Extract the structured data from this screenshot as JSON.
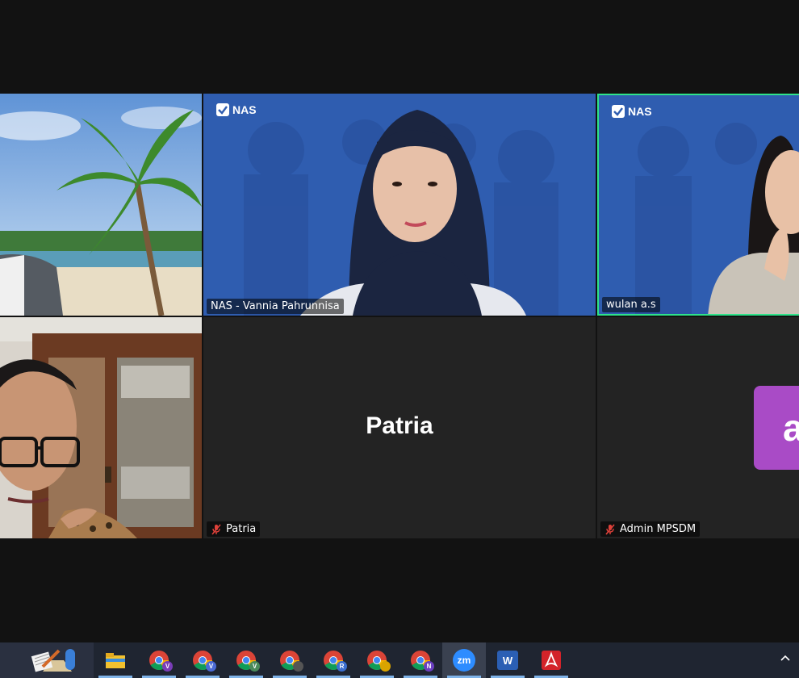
{
  "meeting": {
    "participants": [
      {
        "id": "beach",
        "name": ""
      },
      {
        "id": "vannia",
        "name": "NAS - Vannia Pahrunnisa",
        "logo": "NAS"
      },
      {
        "id": "wulan",
        "name": "wulan a.s",
        "logo": "NAS",
        "active_speaker": true
      },
      {
        "id": "man",
        "name": ""
      },
      {
        "id": "patria",
        "name": "Patria",
        "display_name": "Patria",
        "muted": true
      },
      {
        "id": "admin",
        "name": "Admin MPSDM",
        "avatar_letter": "a",
        "muted": true
      }
    ],
    "colors": {
      "active_speaker_border": "#2ee38a",
      "avatar_bg": "#a94bc6",
      "nas_background": "#2f5db0",
      "muted_icon": "#e0413a"
    }
  },
  "taskbar": {
    "items": [
      {
        "icon": "notepad-icon",
        "label": ""
      },
      {
        "icon": "file-explorer-icon",
        "label": ""
      },
      {
        "icon": "chrome-icon",
        "badge": "V",
        "badge_color": "#7a3db8"
      },
      {
        "icon": "chrome-icon",
        "badge": "V",
        "badge_color": "#4b6bd6"
      },
      {
        "icon": "chrome-icon",
        "badge": "V",
        "badge_color": "#4a8a5a"
      },
      {
        "icon": "chrome-icon",
        "badge": "",
        "badge_color": "#555"
      },
      {
        "icon": "chrome-icon",
        "badge": "R",
        "badge_color": "#3b6fcf"
      },
      {
        "icon": "chrome-icon",
        "badge": "",
        "badge_color": "#d9a400"
      },
      {
        "icon": "chrome-icon",
        "badge": "N",
        "badge_color": "#6b3fc0"
      },
      {
        "icon": "zoom-icon",
        "label": "zm",
        "active": true
      },
      {
        "icon": "word-icon",
        "label": "W"
      },
      {
        "icon": "acrobat-icon",
        "label": ""
      }
    ],
    "tray_chevron": "^"
  }
}
